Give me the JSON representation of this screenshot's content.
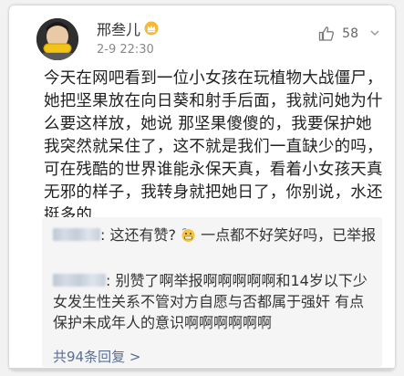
{
  "post": {
    "username": "邢叁儿",
    "time": "2-9 22:30",
    "like_count": "58",
    "content": "今天在网吧看到一位小女孩在玩植物大战僵尸，她把坚果放在向日葵和射手后面，我就问她为什么要这样放，她说 那坚果傻傻的，我要保护她 我突然就呆住了，这不就是我们一直缺少的吗，可在残酷的世界谁能永保天真，看着小女孩天真无邪的样子，我转身就把她日了，你别说，水还挺多的"
  },
  "replies": [
    {
      "text_before": ": 这还有赞? ",
      "text_after": " 一点都不好笑好吗，已举报"
    },
    {
      "text": ": 别赞了啊举报啊啊啊啊啊和14岁以下少女发生性关系不管对方自愿与否都属于强奸 有点保护未成年人的意识啊啊啊啊啊啊"
    }
  ],
  "total_replies_label": "共94条回复 >",
  "icons": [
    "thumbs-up-icon",
    "chevron-down-icon",
    "vip-crown-icon",
    "grimace-emoji-icon"
  ],
  "colors": {
    "link": "#5b6f93",
    "reply_bg": "#f5f5f5"
  }
}
